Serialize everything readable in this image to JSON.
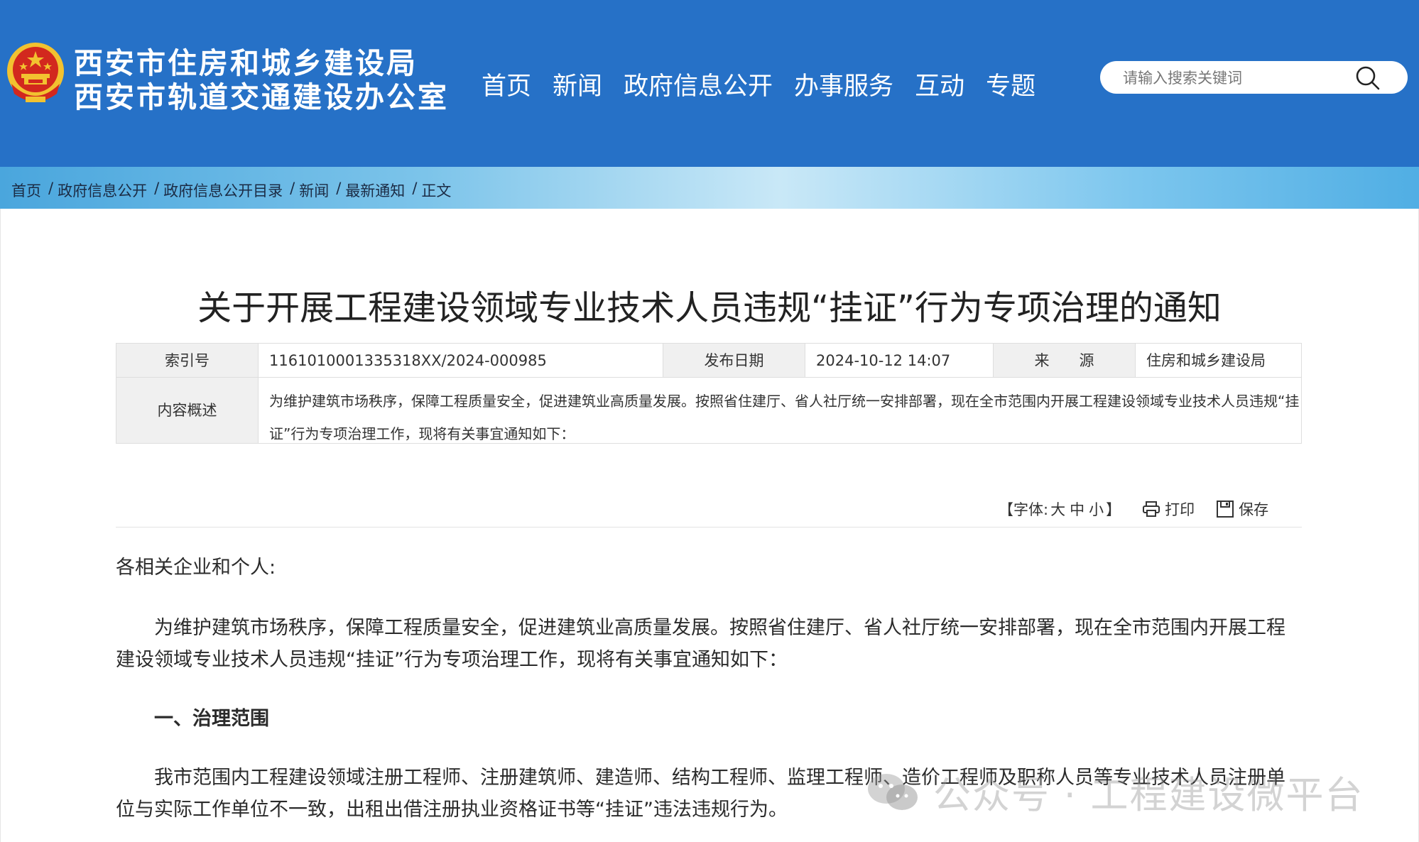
{
  "header": {
    "title_line1": "西安市住房和城乡建设局",
    "title_line2": "西安市轨道交通建设办公室",
    "nav": [
      "首页",
      "新闻",
      "政府信息公开",
      "办事服务",
      "互动",
      "专题"
    ],
    "search_placeholder": "请输入搜索关键词"
  },
  "breadcrumb": [
    "首页",
    "政府信息公开",
    "政府信息公开目录",
    "新闻",
    "最新通知",
    "正文"
  ],
  "article": {
    "title": "关于开展工程建设领域专业技术人员违规“挂证”行为专项治理的通知",
    "meta": {
      "index_label": "索引号",
      "index_value": "1161010001335318XX/2024-000985",
      "date_label": "发布日期",
      "date_value": "2024-10-12 14:07",
      "source_label": "来　　源",
      "source_value": "住房和城乡建设局",
      "summary_label": "内容概述",
      "summary_value": "为维护建筑市场秩序，保障工程质量安全，促进建筑业高质量发展。按照省住建厅、省人社厅统一安排部署，现在全市范围内开展工程建设领域专业技术人员违规“挂证”行为专项治理工作，现将有关事宜通知如下："
    },
    "toolbar": {
      "font_open": "【字体:",
      "font_large": "大",
      "font_medium": "中",
      "font_small": "小",
      "font_close": "】",
      "print": "打印",
      "save": "保存"
    },
    "salutation": "各相关企业和个人:",
    "paragraph1": "为维护建筑市场秩序，保障工程质量安全，促进建筑业高质量发展。按照省住建厅、省人社厅统一安排部署，现在全市范围内开展工程建设领域专业技术人员违规“挂证”行为专项治理工作，现将有关事宜通知如下：",
    "heading1": "一、治理范围",
    "paragraph2": "我市范围内工程建设领域注册工程师、注册建筑师、建造师、结构工程师、监理工程师、造价工程师及职称人员等专业技术人员注册单位与实际工作单位不一致，出租出借注册执业资格证书等“挂证”违法违规行为。"
  },
  "watermark": "公众号 · 工程建设微平台",
  "colors": {
    "header_bg": "#2671c7",
    "emblem_red": "#d2281e",
    "emblem_gold": "#f2c230"
  }
}
